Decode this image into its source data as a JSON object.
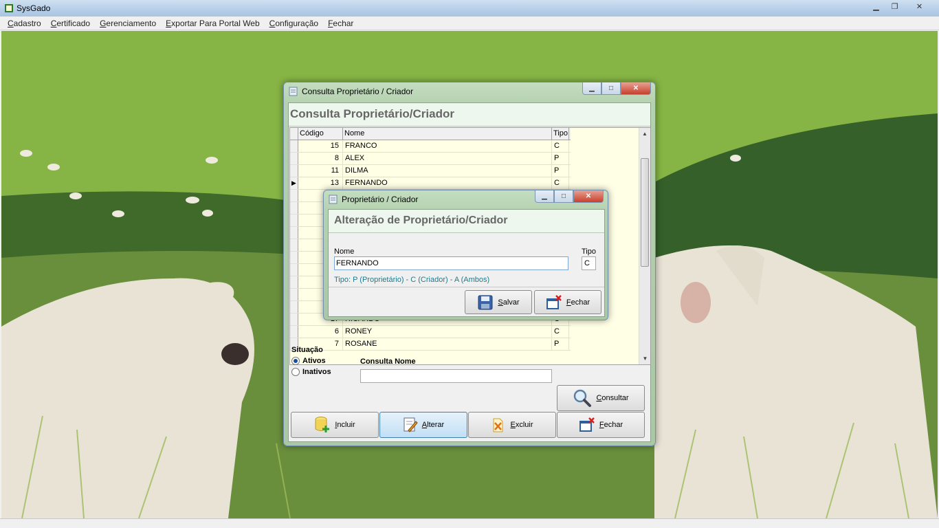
{
  "app": {
    "title": "SysGado",
    "menu": [
      {
        "pre": "",
        "ul": "C",
        "post": "adastro"
      },
      {
        "pre": "",
        "ul": "C",
        "post": "ertificado"
      },
      {
        "pre": "",
        "ul": "G",
        "post": "erenciamento"
      },
      {
        "pre": "",
        "ul": "E",
        "post": "xportar Para Portal Web"
      },
      {
        "pre": "",
        "ul": "C",
        "post": "onfiguração"
      },
      {
        "pre": "",
        "ul": "F",
        "post": "echar"
      }
    ]
  },
  "consulta": {
    "window_title": "Consulta Proprietário / Criador",
    "heading": "Consulta Proprietário/Criador",
    "columns": [
      "Código",
      "Nome",
      "Tipo"
    ],
    "rows": [
      {
        "codigo": "15",
        "nome": " FRANCO",
        "tipo": "C",
        "current": false
      },
      {
        "codigo": "8",
        "nome": "ALEX",
        "tipo": "P",
        "current": false
      },
      {
        "codigo": "11",
        "nome": "DILMA",
        "tipo": "P",
        "current": false
      },
      {
        "codigo": "13",
        "nome": "FERNANDO",
        "tipo": "C",
        "current": true
      },
      {
        "codigo": "",
        "nome": "",
        "tipo": "",
        "current": false
      },
      {
        "codigo": "",
        "nome": "",
        "tipo": "",
        "current": false
      },
      {
        "codigo": "",
        "nome": "",
        "tipo": "",
        "current": false
      },
      {
        "codigo": "",
        "nome": "",
        "tipo": "",
        "current": false
      },
      {
        "codigo": "",
        "nome": "",
        "tipo": "",
        "current": false
      },
      {
        "codigo": "",
        "nome": "",
        "tipo": "",
        "current": false
      },
      {
        "codigo": "",
        "nome": "",
        "tipo": "",
        "current": false
      },
      {
        "codigo": "",
        "nome": "",
        "tipo": "",
        "current": false
      },
      {
        "codigo": "",
        "nome": "",
        "tipo": "",
        "current": false
      },
      {
        "codigo": "",
        "nome": "",
        "tipo": "",
        "current": false
      },
      {
        "codigo": "17",
        "nome": "RICARDO",
        "tipo": "C",
        "current": false
      },
      {
        "codigo": "6",
        "nome": "RONEY",
        "tipo": "C",
        "current": false
      },
      {
        "codigo": "7",
        "nome": "ROSANE",
        "tipo": "P",
        "current": false
      }
    ],
    "situacao_label": "Situação",
    "situacao_options": [
      {
        "label": "Ativos",
        "selected": true
      },
      {
        "label": "Inativos",
        "selected": false
      }
    ],
    "consulta_nome_label": "Consulta Nome",
    "consulta_nome_value": "",
    "buttons": {
      "consultar": {
        "ul": "C",
        "rest": "onsultar"
      },
      "incluir": {
        "ul": "I",
        "rest": "ncluir"
      },
      "alterar": {
        "ul": "A",
        "rest": "lterar"
      },
      "excluir": {
        "ul": "E",
        "rest": "xcluir"
      },
      "fechar": {
        "ul": "F",
        "rest": "echar"
      }
    }
  },
  "proprietario": {
    "window_title": "Proprietário / Criador",
    "heading": "Alteração de Proprietário/Criador",
    "nome_label": "Nome",
    "nome_value": "FERNANDO",
    "tipo_label": "Tipo",
    "tipo_value": "C",
    "hint": "Tipo: P (Proprietário) - C (Criador) - A (Ambos)",
    "buttons": {
      "salvar": {
        "ul": "S",
        "rest": "alvar"
      },
      "fechar": {
        "ul": "F",
        "rest": "echar"
      }
    }
  }
}
